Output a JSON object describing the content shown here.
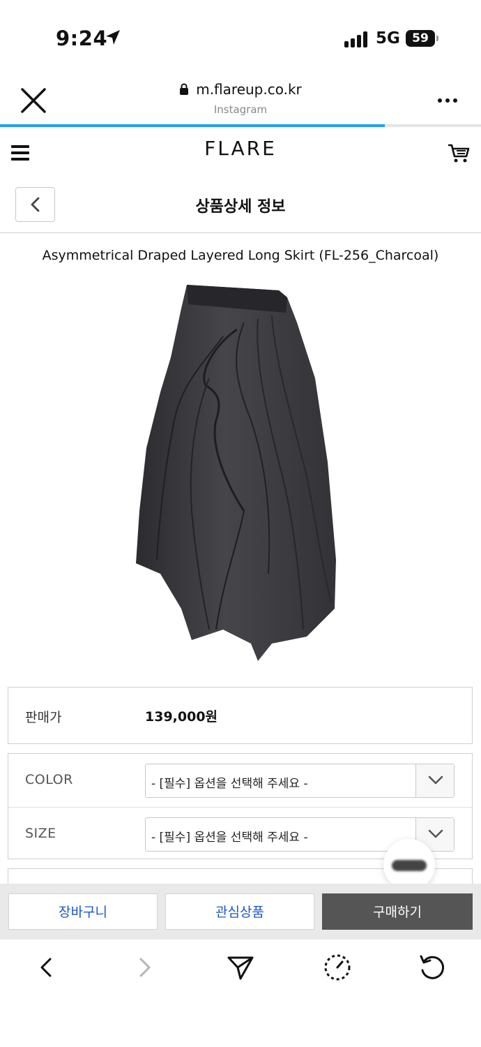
{
  "status_bar": {
    "time": "9:24",
    "network": "5G",
    "battery": "59",
    "icons": [
      "location-arrow-icon",
      "signal-bars-icon"
    ]
  },
  "browser": {
    "url": "m.flareup.co.kr",
    "source": "Instagram",
    "progress_percent": 80,
    "icons": [
      "close-icon",
      "lock-icon",
      "more-icon"
    ]
  },
  "site": {
    "brand": "FLARE",
    "icons": [
      "menu-icon",
      "cart-icon"
    ]
  },
  "page": {
    "title": "상품상세 정보",
    "back_icon": "chevron-left-icon"
  },
  "product": {
    "name": "Asymmetrical Draped Layered Long Skirt (FL-256_Charcoal)",
    "image": "charcoal-draped-skirt-image",
    "color": "#3b3b3f"
  },
  "price": {
    "label": "판매가",
    "value": "139,000원"
  },
  "options": [
    {
      "label": "COLOR",
      "placeholder": "- [필수] 옵션을 선택해 주세요 -"
    },
    {
      "label": "SIZE",
      "placeholder": "- [필수] 옵션을 선택해 주세요 -"
    }
  ],
  "actions": {
    "cart": "장바구니",
    "wishlist": "관심상품",
    "buy": "구매하기",
    "accent": "#1a56c4",
    "buy_bg": "#555555"
  },
  "toolbar": {
    "icons": [
      "back-icon",
      "forward-icon",
      "share-icon",
      "history-icon",
      "reload-icon"
    ]
  }
}
